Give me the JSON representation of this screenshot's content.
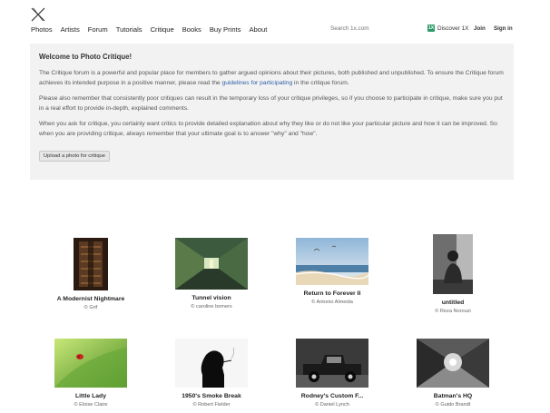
{
  "header": {
    "nav": [
      "Photos",
      "Artists",
      "Forum",
      "Tutorials",
      "Critique",
      "Books",
      "Buy Prints",
      "About"
    ],
    "search_placeholder": "Search 1x.com",
    "discover_label": "Discover 1X",
    "badge_text": "1X",
    "join_label": "Join",
    "signin_label": "Sign in"
  },
  "welcome": {
    "title": "Welcome to Photo Critique!",
    "p1_a": "The Critique forum is a powerful and popular place for members to gather argued opinions about their pictures, both published and unpublished. To ensure the Critique forum achieves its intended purpose in a positive manner, please read the ",
    "p1_link": "guidelines for participating",
    "p1_b": " in the critique forum.",
    "p2": "Please also remember that consistently poor critiques can result in the temporary loss of your critique privileges, so if you choose to participate in critique, make sure you put in a real effort to provide in-depth, explained comments.",
    "p3": "When you ask for critique, you certainly want critics to provide detailed explanation about why they like or do not like your particular picture and how it can be improved. So when you are providing critique, always remember that your ultimate goal is to answer \"why\" and \"how\".",
    "upload_label": "Upload a photo for critique"
  },
  "photos": [
    {
      "title": "A Modernist Nightmare",
      "author": "© Grif"
    },
    {
      "title": "Tunnel vision",
      "author": "© caroline bomers"
    },
    {
      "title": "Return to Forever II",
      "author": "© Antonio Almeida"
    },
    {
      "title": "untitled",
      "author": "© Reza Norouzi"
    },
    {
      "title": "Little Lady",
      "author": "© Eloise Claire"
    },
    {
      "title": "1950's Smoke Break",
      "author": "© Robert Fielder"
    },
    {
      "title": "Rodney's Custom F...",
      "author": "© Daniel Lynch"
    },
    {
      "title": "Batman's HQ",
      "author": "© Guido Brandt"
    }
  ]
}
